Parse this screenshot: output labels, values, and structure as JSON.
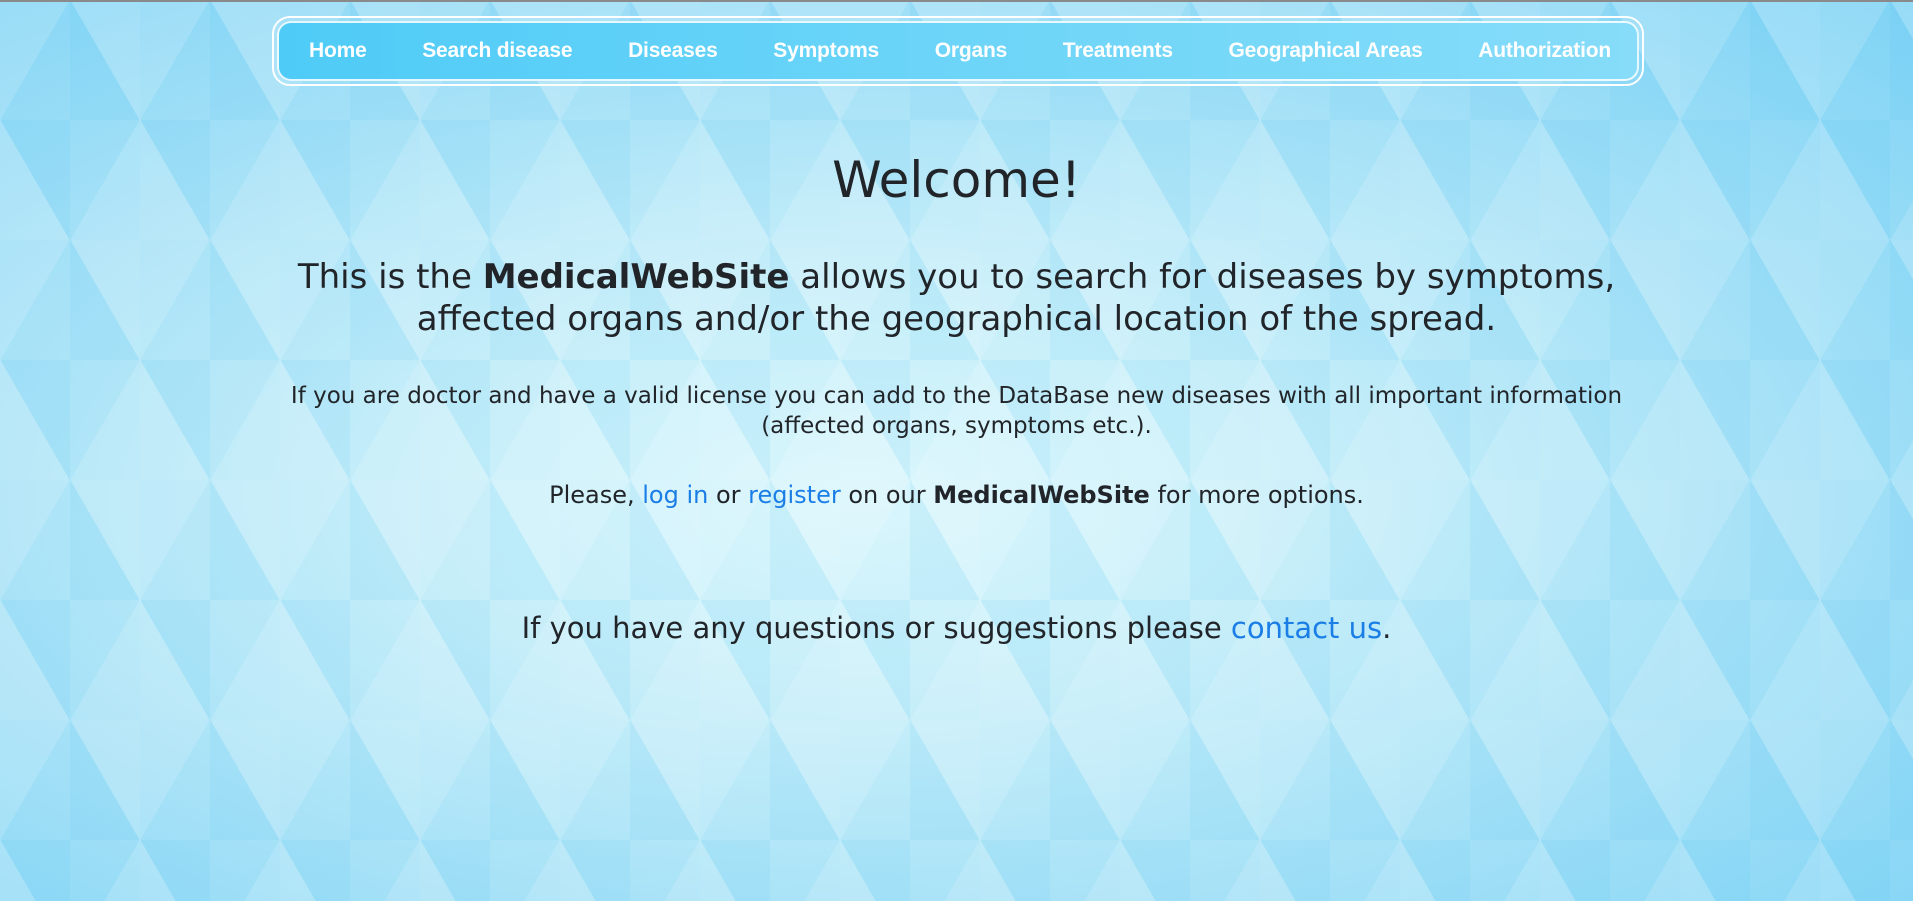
{
  "nav": {
    "items": [
      {
        "label": "Home"
      },
      {
        "label": "Search disease"
      },
      {
        "label": "Diseases"
      },
      {
        "label": "Symptoms"
      },
      {
        "label": "Organs"
      },
      {
        "label": "Treatments"
      },
      {
        "label": "Geographical Areas"
      },
      {
        "label": "Authorization"
      }
    ]
  },
  "main": {
    "welcome": "Welcome!",
    "intro": {
      "prefix": "This is the ",
      "site_name": "MedicalWebSite",
      "suffix": " allows you to search for diseases by symptoms, affected organs and/or the geographical location of the spread."
    },
    "doctor_text": "If you are doctor and have a valid license you can add to the DataBase new diseases with all important information (affected organs, symptoms etc.).",
    "please": {
      "prefix": "Please, ",
      "login_link": "log in",
      "or": " or ",
      "register_link": "register",
      "middle": " on our ",
      "site_name": "MedicalWebSite",
      "suffix": " for more options."
    },
    "contact": {
      "prefix": "If you have any questions or suggestions please ",
      "link": "contact us",
      "suffix": "."
    }
  },
  "colors": {
    "link": "#1b7ee6",
    "nav_background": "#5fd0f8",
    "text": "#212529"
  }
}
